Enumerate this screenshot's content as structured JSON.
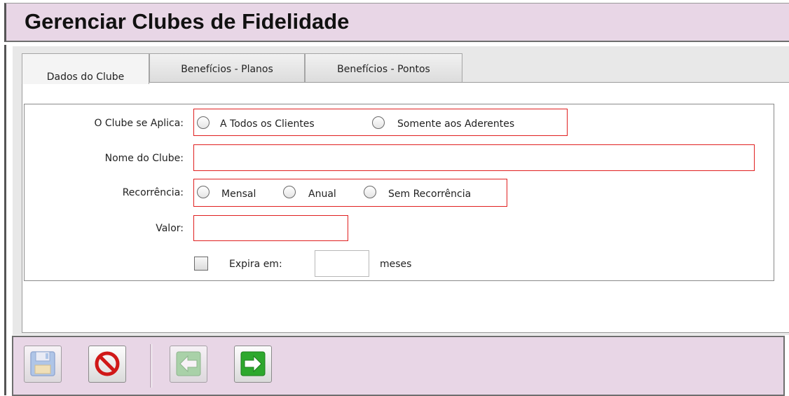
{
  "header": {
    "title": "Gerenciar Clubes de Fidelidade"
  },
  "tabs": [
    {
      "label": "Dados do Clube",
      "active": true
    },
    {
      "label": "Benefícios - Planos",
      "active": false
    },
    {
      "label": "Benefícios - Pontos",
      "active": false
    }
  ],
  "form": {
    "aplica": {
      "label": "O Clube se Aplica:",
      "options": [
        "A Todos os Clientes",
        "Somente aos Aderentes"
      ],
      "selected": null
    },
    "nome": {
      "label": "Nome do Clube:",
      "value": ""
    },
    "recorrencia": {
      "label": "Recorrência:",
      "options": [
        "Mensal",
        "Anual",
        "Sem Recorrência"
      ],
      "selected": null
    },
    "valor": {
      "label": "Valor:",
      "value": ""
    },
    "expira": {
      "label": "Expira em:",
      "checked": false,
      "value": "",
      "unit": "meses"
    }
  },
  "toolbar": {
    "buttons": [
      {
        "icon": "save-icon",
        "enabled": false
      },
      {
        "icon": "cancel-icon",
        "enabled": true
      },
      {
        "icon": "arrow-left-icon",
        "enabled": false
      },
      {
        "icon": "arrow-right-icon",
        "enabled": true
      }
    ]
  },
  "colors": {
    "header_bg": "#e8d6e6",
    "required_border": "#e02020",
    "arrow_green": "#2da82d",
    "cancel_red": "#d01818"
  }
}
